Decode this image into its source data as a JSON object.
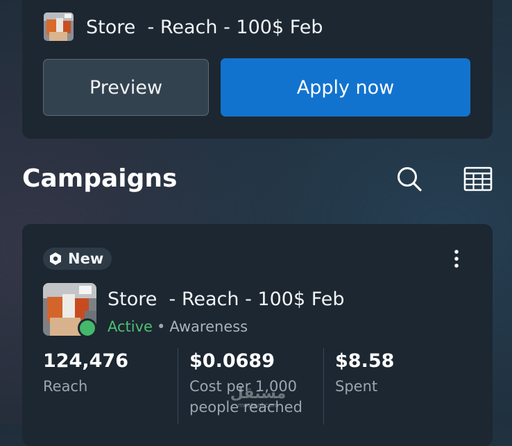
{
  "ad_preview": {
    "ad_name": "Store  - Reach - 100$ Feb",
    "preview_label": "Preview",
    "apply_label": "Apply now"
  },
  "campaigns_header": {
    "title": "Campaigns",
    "search_icon": "search-icon",
    "table_icon": "table-view-icon"
  },
  "campaign": {
    "badge": "New",
    "name": "Store  - Reach - 100$ Feb",
    "status": "Active",
    "separator": "•",
    "objective": "Awareness",
    "status_color": "#44b86b",
    "metrics": [
      {
        "value": "124,476",
        "label": "Reach"
      },
      {
        "value": "$0.0689",
        "label": "Cost per 1,000 people reached"
      },
      {
        "value": "$8.58",
        "label": "Spent"
      }
    ]
  },
  "watermark": {
    "text": "مستقل",
    "sub": "mostaql.com"
  },
  "colors": {
    "accent": "#1273cf",
    "card": "#1c2731",
    "active": "#4fbf72"
  }
}
